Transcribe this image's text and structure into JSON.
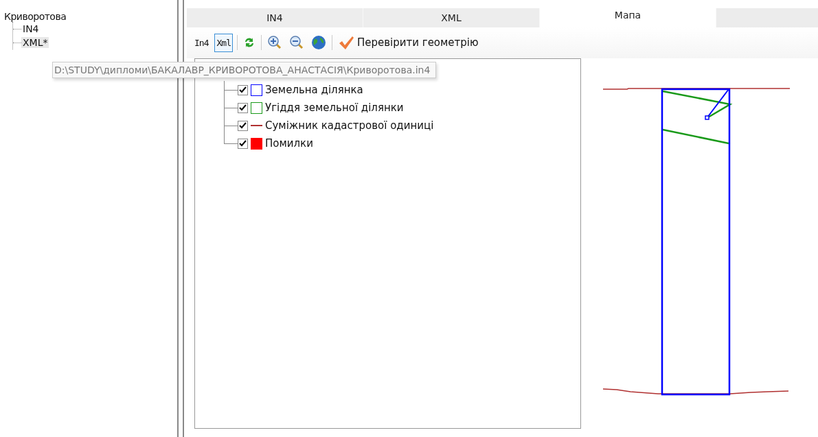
{
  "project_tree": {
    "label": "Криворотова",
    "children": [
      {
        "label": "IN4",
        "selected": false
      },
      {
        "label": "XML*",
        "selected": true
      }
    ]
  },
  "tooltip": "D:\\STUDY\\дипломи\\БАКАЛАВР_КРИВОРОТОВА_АНАСТАСІЯ\\Криворотова.in4",
  "tabs": [
    {
      "label": "IN4",
      "selected": false
    },
    {
      "label": "XML",
      "selected": false
    },
    {
      "label": "Мапа",
      "selected": true
    }
  ],
  "toolbar": [
    {
      "kind": "text",
      "label": "In4",
      "pressed": false
    },
    {
      "kind": "text",
      "label": "Xml",
      "pressed": true
    },
    {
      "kind": "separator"
    },
    {
      "kind": "refresh"
    },
    {
      "kind": "separator"
    },
    {
      "kind": "zoom-in"
    },
    {
      "kind": "zoom-out"
    },
    {
      "kind": "globe"
    },
    {
      "kind": "separator"
    },
    {
      "kind": "check",
      "label": "Перевірити геометрію"
    }
  ],
  "layers": {
    "children": [
      {
        "label": "Земельна ділянка",
        "checked": true,
        "kind": "outline",
        "color": "#0000ff"
      },
      {
        "label": "Угіддя земельної ділянки",
        "checked": true,
        "kind": "outline",
        "color": "#1a9a1a"
      },
      {
        "label": "Суміжник кадастрової одиниці",
        "checked": true,
        "kind": "line",
        "color": "#b03030"
      },
      {
        "label": "Помилки",
        "checked": true,
        "kind": "fill",
        "color": "#ff0000"
      }
    ]
  }
}
